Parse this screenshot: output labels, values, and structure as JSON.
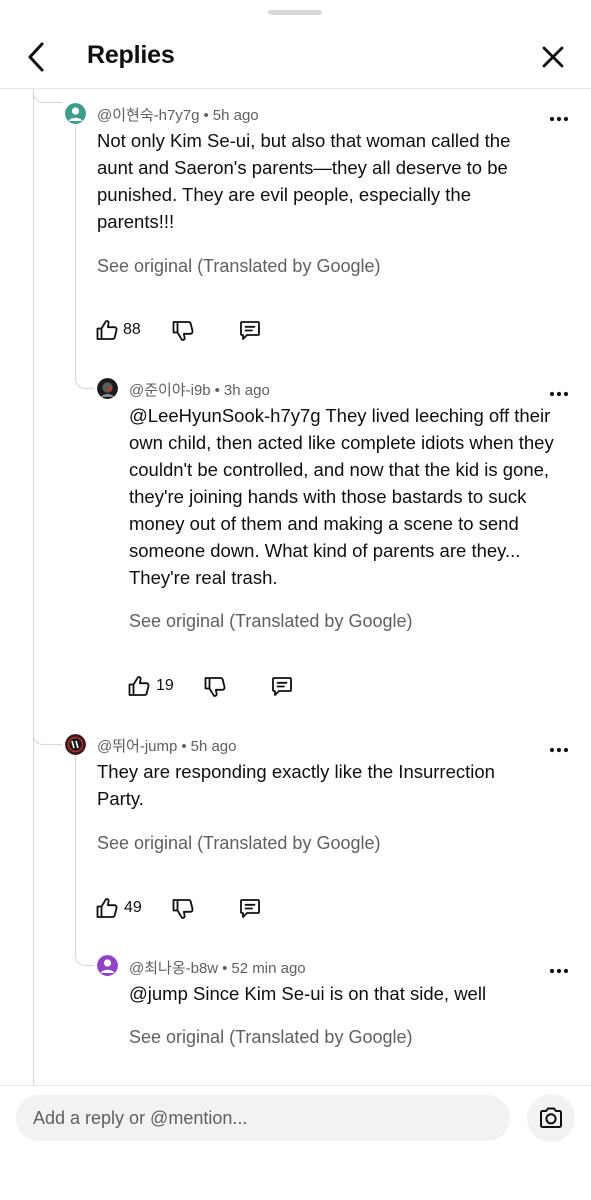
{
  "header": {
    "title": "Replies"
  },
  "comments": [
    {
      "author": "@이현숙-h7y7g",
      "time": "5h ago",
      "text": "Not only Kim Se-ui, but also that woman called the aunt and Saeron's parents—they all deserve to be punished. They are evil people, especially the parents!!!",
      "see_original": "See original (Translated by Google)",
      "likes": "88",
      "avatar_color": "#3f9b8c"
    },
    {
      "author": "@준이야-i9b",
      "time": "3h ago",
      "text": "@LeeHyunSook-h7y7g They lived leeching off their own child, then acted like complete idiots when they couldn't be controlled, and now that the kid is gone, they're joining hands with those bastards to suck money out of them and making a scene to send someone down. What kind of parents are they... They're real trash.",
      "see_original": "See original (Translated by Google)",
      "likes": "19",
      "avatar_color": "#1a1a1a"
    },
    {
      "author": "@뛰어-jump",
      "time": "5h ago",
      "text": "They are responding exactly like the Insurrection Party.",
      "see_original": "See original (Translated by Google)",
      "likes": "49",
      "avatar_color": "#3a1a1a"
    },
    {
      "author": "@최나옹-b8w",
      "time": "52 min ago",
      "text": "@jump Since Kim Se-ui is on that side, well",
      "see_original": "See original (Translated by Google)",
      "avatar_color": "#8e44c4"
    }
  ],
  "composer": {
    "placeholder": "Add a reply or @mention..."
  },
  "icons": {
    "back": "chevron-left-icon",
    "close": "close-icon",
    "more": "more-vert-icon",
    "like": "thumbs-up-icon",
    "dislike": "thumbs-down-icon",
    "reply": "comment-icon",
    "camera": "camera-icon"
  }
}
